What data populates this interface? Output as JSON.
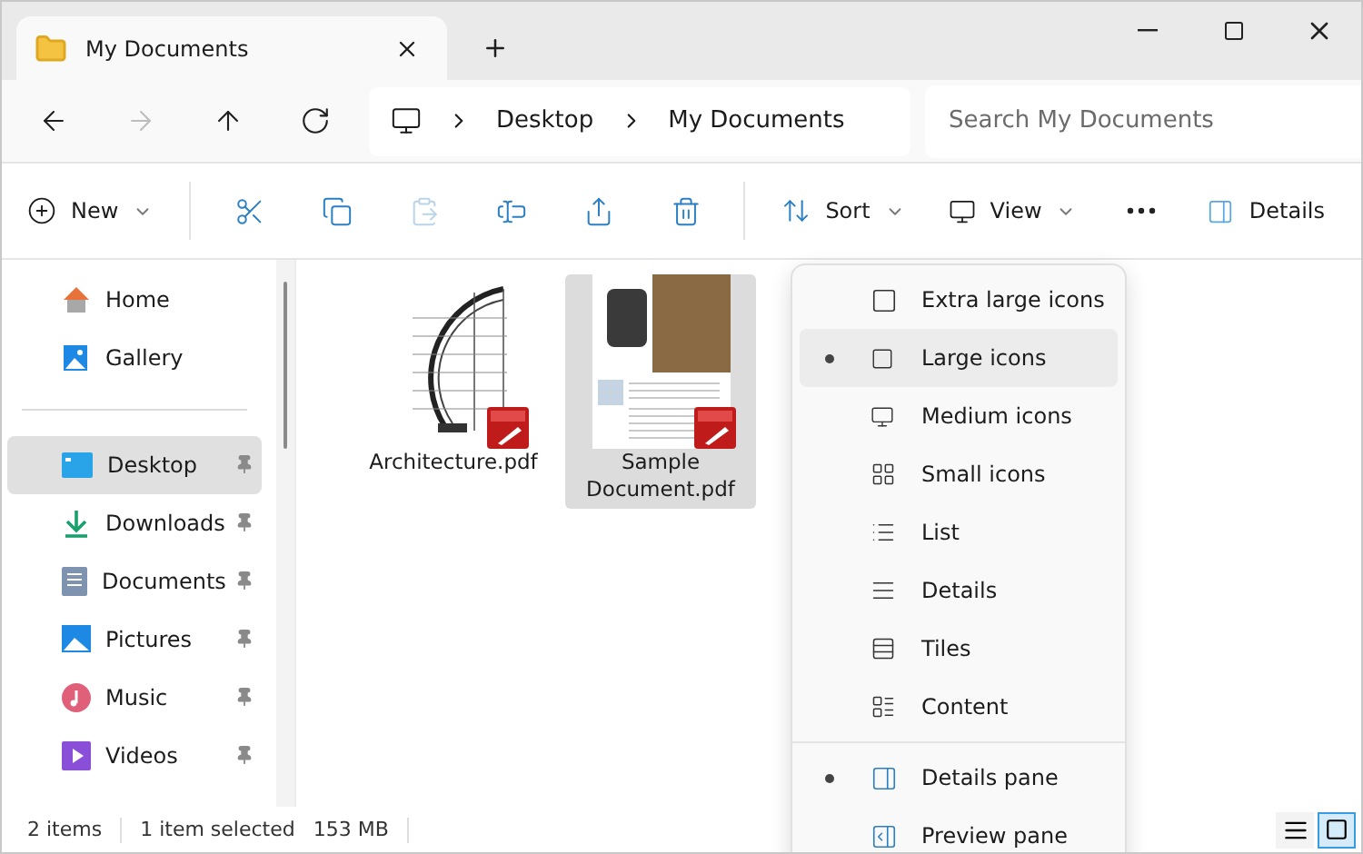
{
  "window": {
    "title": "My Documents"
  },
  "nav_buttons": [
    {
      "disabled": false
    },
    {
      "disabled": true
    },
    {
      "disabled": false
    },
    {
      "disabled": false
    }
  ],
  "breadcrumb": [
    "Desktop",
    "My Documents"
  ],
  "search": {
    "placeholder": "Search My Documents"
  },
  "toolbar": {
    "new": "New",
    "actions": [
      {
        "disabled": false
      },
      {
        "disabled": false
      },
      {
        "disabled": true
      },
      {
        "disabled": false
      },
      {
        "disabled": false
      },
      {
        "disabled": false
      }
    ],
    "sort": "Sort",
    "view": "View",
    "details": "Details"
  },
  "sidebar": {
    "top_items": [
      {
        "label": "Home",
        "selected": false,
        "pinned": false
      },
      {
        "label": "Gallery",
        "selected": false,
        "pinned": false
      }
    ],
    "items": [
      {
        "label": "Desktop",
        "selected": true,
        "pinned": true
      },
      {
        "label": "Downloads",
        "selected": false,
        "pinned": true
      },
      {
        "label": "Documents",
        "selected": false,
        "pinned": true
      },
      {
        "label": "Pictures",
        "selected": false,
        "pinned": true
      },
      {
        "label": "Music",
        "selected": false,
        "pinned": true
      },
      {
        "label": "Videos",
        "selected": false,
        "pinned": true
      }
    ]
  },
  "files": [
    {
      "name": "Architecture.pdf",
      "selected": false
    },
    {
      "name": "Sample Document.pdf",
      "selected": true
    }
  ],
  "view_menu": {
    "layouts": [
      {
        "label": "Extra large icons",
        "selected": false,
        "highlighted": false
      },
      {
        "label": "Large icons",
        "selected": true,
        "highlighted": true
      },
      {
        "label": "Medium icons",
        "selected": false,
        "highlighted": false
      },
      {
        "label": "Small icons",
        "selected": false,
        "highlighted": false
      },
      {
        "label": "List",
        "selected": false,
        "highlighted": false
      },
      {
        "label": "Details",
        "selected": false,
        "highlighted": false
      },
      {
        "label": "Tiles",
        "selected": false,
        "highlighted": false
      },
      {
        "label": "Content",
        "selected": false,
        "highlighted": false
      }
    ],
    "panes": [
      {
        "label": "Details pane",
        "selected": true,
        "highlighted": false
      },
      {
        "label": "Preview pane",
        "selected": false,
        "highlighted": false
      }
    ]
  },
  "status_bar": {
    "count": "2 items",
    "selection": "1 item selected",
    "size": "153 MB",
    "view_toggles": [
      {
        "selected": false
      },
      {
        "selected": true
      }
    ]
  }
}
